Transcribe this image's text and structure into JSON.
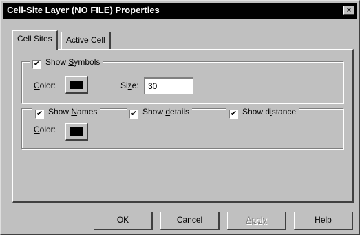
{
  "window": {
    "title": "Cell-Site Layer (NO FILE) Properties",
    "close_label": "×"
  },
  "tabs": [
    {
      "label": "Cell Sites",
      "active": true
    },
    {
      "label": "Active Cell",
      "active": false
    }
  ],
  "symbols_group": {
    "checkbox_label_pre": "Show ",
    "checkbox_label_key": "S",
    "checkbox_label_post": "ymbols",
    "checked": true,
    "color_label_key": "C",
    "color_label_post": "olor:",
    "color_value": "#000000",
    "size_label_pre": "Si",
    "size_label_key": "z",
    "size_label_post": "e:",
    "size_value": "30"
  },
  "names_group": {
    "show_names": {
      "pre": "Show ",
      "key": "N",
      "post": "ames",
      "checked": true
    },
    "show_details": {
      "pre": "Show ",
      "key": "d",
      "post": "etails",
      "checked": true
    },
    "show_distance": {
      "pre": "Show d",
      "key": "i",
      "post": "stance",
      "checked": true
    },
    "color_label_key": "C",
    "color_label_post": "olor:",
    "color_value": "#000000"
  },
  "checkmark": "✔",
  "buttons": {
    "ok": "OK",
    "cancel": "Cancel",
    "apply": "Apply",
    "help": "Help"
  }
}
